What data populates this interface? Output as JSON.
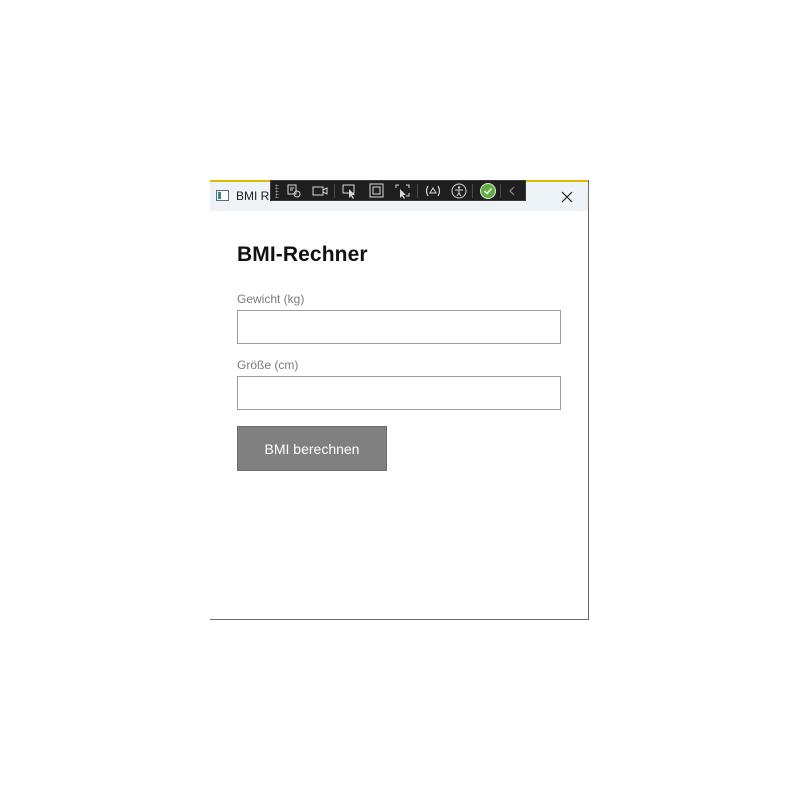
{
  "window": {
    "title": "BMI Rechner",
    "title_visible": "BMI Re",
    "accent_color": "#e3b505",
    "titlebar_color": "#eef3f8"
  },
  "dev_toolbar": {
    "items": [
      {
        "icon": "live-visual-tree-icon"
      },
      {
        "icon": "record-video-icon"
      },
      {
        "icon": "select-element-icon"
      },
      {
        "icon": "display-layout-adorners-icon"
      },
      {
        "icon": "track-focus-icon"
      },
      {
        "icon": "binding-failures-icon"
      },
      {
        "icon": "accessibility-checker-icon"
      },
      {
        "icon": "status-ok-icon"
      },
      {
        "icon": "collapse-chevron-icon"
      }
    ]
  },
  "form": {
    "heading": "BMI-Rechner",
    "weight_label": "Gewicht (kg)",
    "weight_value": "",
    "height_label": "Größe (cm)",
    "height_value": "",
    "submit_label": "BMI berechnen",
    "button_color": "#808080"
  }
}
